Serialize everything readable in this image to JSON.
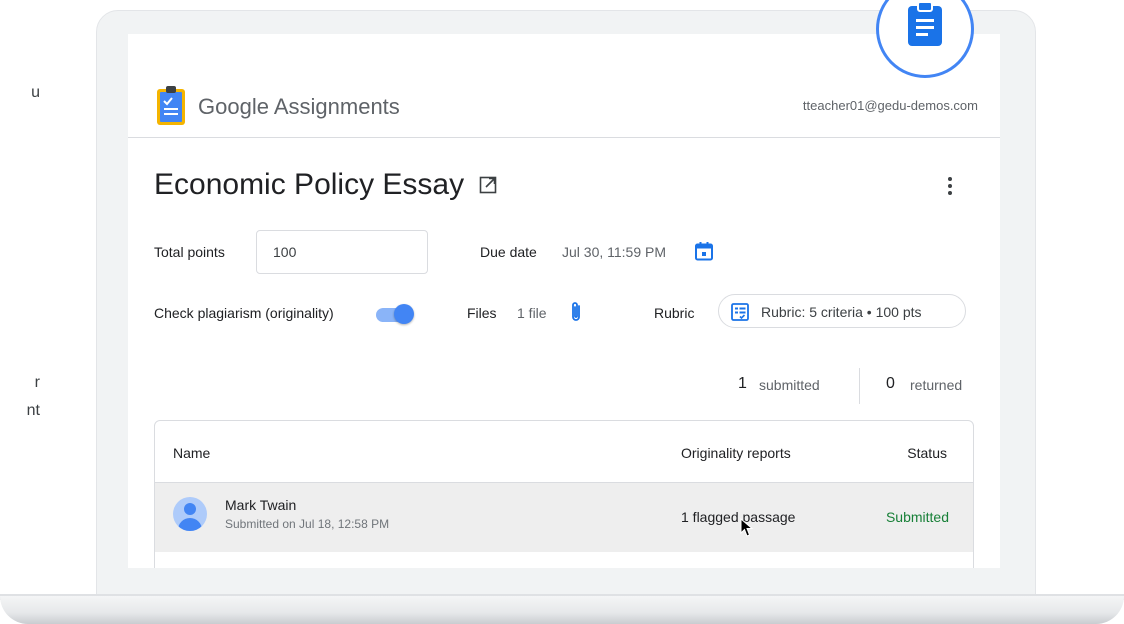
{
  "left_fragments": [
    {
      "text": "u"
    },
    {
      "text": "r"
    },
    {
      "text": "nt"
    }
  ],
  "app": {
    "brand_google": "Google",
    "brand_product": "Assignments",
    "account_email": "tteacher01@gedu-demos.com"
  },
  "assignment": {
    "title": "Economic Policy Essay",
    "total_points_label": "Total points",
    "total_points_value": "100",
    "due_date_label": "Due date",
    "due_date_value": "Jul 30, 11:59 PM",
    "plagiarism_label": "Check plagiarism (originality)",
    "plagiarism_enabled": true,
    "files_label": "Files",
    "files_value": "1 file",
    "rubric_label": "Rubric",
    "rubric_chip": "Rubric: 5 criteria • 100 pts"
  },
  "counts": {
    "submitted_num": "1",
    "submitted_label": "submitted",
    "returned_num": "0",
    "returned_label": "returned"
  },
  "table": {
    "headers": [
      "Name",
      "Originality reports",
      "Status"
    ],
    "rows": [
      {
        "name": "Mark Twain",
        "submitted_on": "Submitted on Jul 18, 12:58 PM",
        "originality": "1 flagged passage",
        "status": "Submitted"
      }
    ]
  },
  "colors": {
    "accent": "#4285f4",
    "status_submitted": "#188038",
    "selected_row": "#eeeeee"
  },
  "icons": [
    "assignments-logo-icon",
    "open-in-new-icon",
    "more-vert-icon",
    "calendar-icon",
    "paperclip-icon",
    "rubric-icon",
    "avatar-icon",
    "cursor-arrow-icon",
    "clipboard-badge-icon"
  ]
}
